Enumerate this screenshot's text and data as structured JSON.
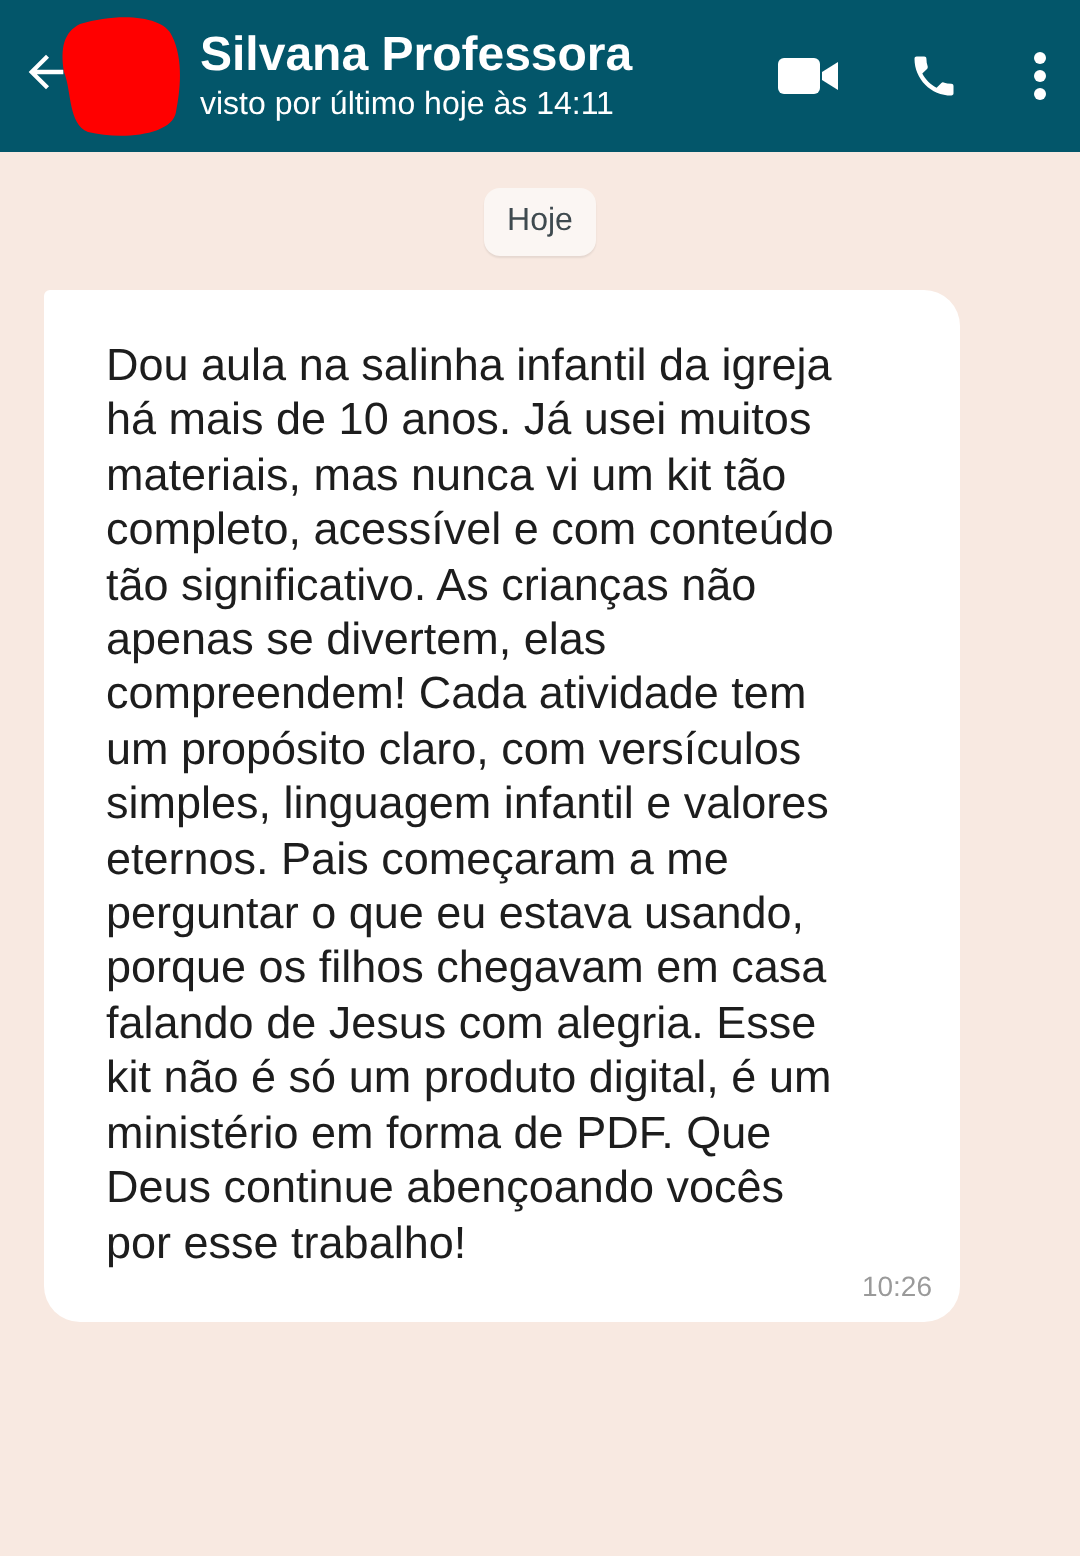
{
  "header": {
    "name": "Silvana Professora",
    "status": "visto por último hoje às 14:11"
  },
  "date_chip": "Hoje",
  "messages": [
    {
      "text": "Dou aula na salinha infantil da igreja\nhá mais de 10 anos. Já usei muitos\nmateriais, mas nunca vi um kit tão\ncompleto, acessível e com conteúdo\ntão significativo. As crianças não\napenas se divertem, elas\ncompreendem! Cada atividade tem\num propósito claro, com versículos\nsimples, linguagem infantil e valores\neternos. Pais começaram a me\nperguntar o que eu estava usando,\nporque os filhos chegavam em casa\nfalando de Jesus com alegria. Esse\nkit não é só um produto digital, é um\nministério em forma de PDF. Que\nDeus continue abençoando vocês\npor esse trabalho!",
      "time": "10:26"
    }
  ]
}
